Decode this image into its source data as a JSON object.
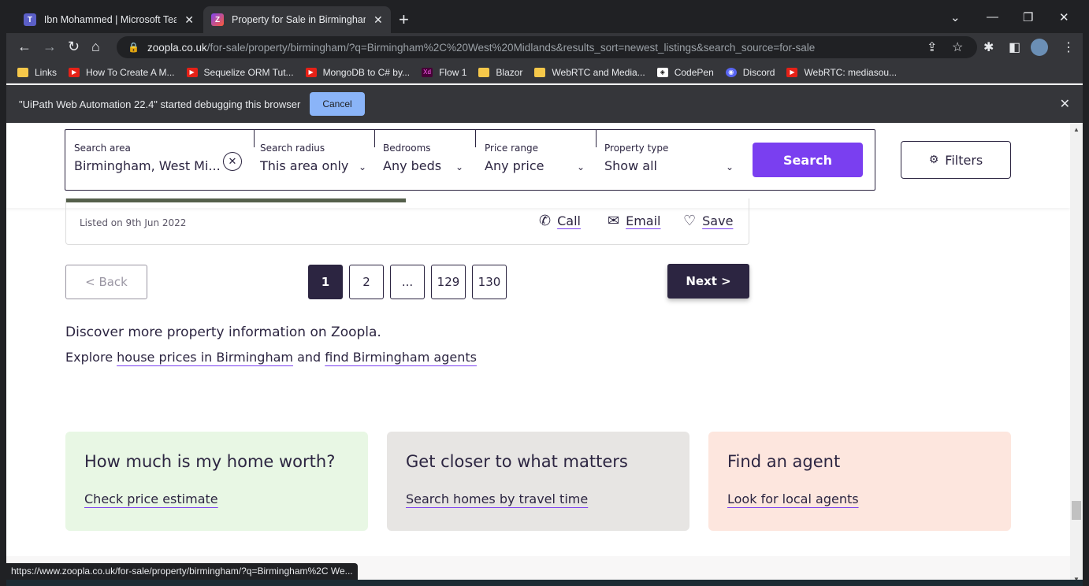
{
  "browser": {
    "tabs": [
      {
        "title": "Ibn Mohammed | Microsoft Teams",
        "icon": "teams-icon"
      },
      {
        "title": "Property for Sale in Birmingham",
        "icon": "zoopla-icon"
      }
    ],
    "url_host": "zoopla.co.uk",
    "url_path": "/for-sale/property/birmingham/?q=Birmingham%2C%20West%20Midlands&results_sort=newest_listings&search_source=for-sale",
    "bookmarks": [
      {
        "label": "Links",
        "icon": "folder"
      },
      {
        "label": "How To Create A M...",
        "icon": "youtube"
      },
      {
        "label": "Sequelize ORM Tut...",
        "icon": "youtube"
      },
      {
        "label": "MongoDB to C# by...",
        "icon": "youtube"
      },
      {
        "label": "Flow 1",
        "icon": "xd"
      },
      {
        "label": "Blazor",
        "icon": "folder"
      },
      {
        "label": "WebRTC and Media...",
        "icon": "folder"
      },
      {
        "label": "CodePen",
        "icon": "codepen"
      },
      {
        "label": "Discord",
        "icon": "discord"
      },
      {
        "label": "WebRTC: mediasou...",
        "icon": "youtube"
      }
    ],
    "debug_message": "\"UiPath Web Automation 22.4\" started debugging this browser",
    "debug_cancel": "Cancel",
    "status_url": "https://www.zoopla.co.uk/for-sale/property/birmingham/?q=Birmingham%2C We..."
  },
  "search": {
    "area_label": "Search area",
    "area_value": "Birmingham, West Mi...",
    "radius_label": "Search radius",
    "radius_value": "This area only",
    "bedrooms_label": "Bedrooms",
    "bedrooms_value": "Any beds",
    "price_label": "Price range",
    "price_value": "Any price",
    "type_label": "Property type",
    "type_value": "Show all",
    "search_button": "Search",
    "filters_button": "Filters"
  },
  "listing": {
    "listed_on": "Listed on 9th Jun 2022",
    "call": "Call",
    "email": "Email",
    "save": "Save"
  },
  "pagination": {
    "back": "< Back",
    "pages": [
      "1",
      "2",
      "...",
      "129",
      "130"
    ],
    "current": "1",
    "next": "Next >"
  },
  "discover": {
    "heading": "Discover more property information on Zoopla.",
    "explore_prefix": "Explore",
    "link1": "house prices in Birmingham",
    "and": "and",
    "link2": "find Birmingham agents"
  },
  "promos": [
    {
      "title": "How much is my home worth?",
      "link": "Check price estimate",
      "bg": "#e8f7e4"
    },
    {
      "title": "Get closer to what matters",
      "link": "Search homes by travel time",
      "bg": "#e7e5e3"
    },
    {
      "title": "Find an agent",
      "link": "Look for local agents",
      "bg": "#fde6de"
    }
  ],
  "colors": {
    "brand_purple": "#7a3ff0",
    "ink": "#2c2541"
  }
}
